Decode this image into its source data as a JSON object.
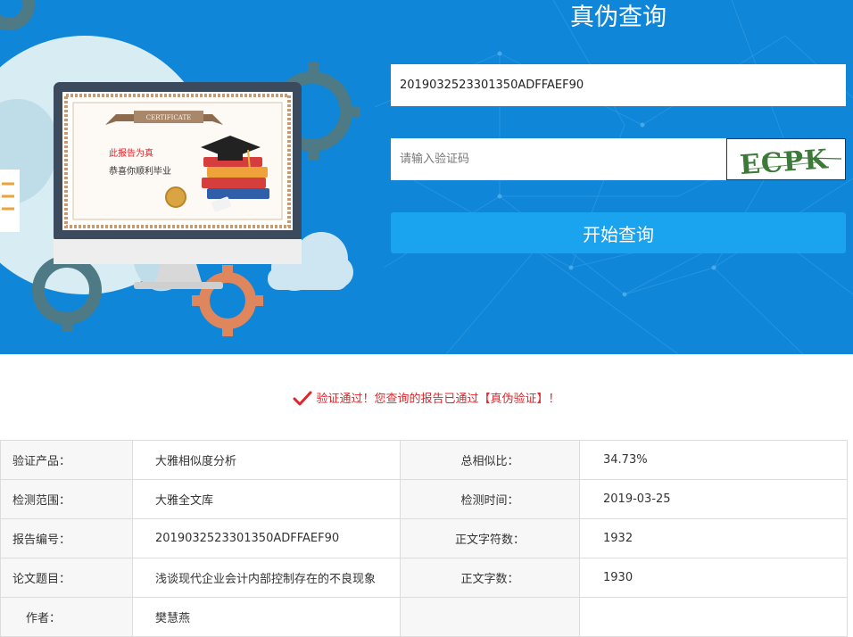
{
  "hero": {
    "title": "真伪查询",
    "certificate": {
      "banner": "CERTIFICATE",
      "line1": "此报告为真",
      "line2": "恭喜你顺利毕业"
    }
  },
  "form": {
    "report_number_value": "2019032523301350ADFFAEF90",
    "captcha_placeholder": "请输入验证码",
    "captcha_text": "ECPK",
    "query_button_label": "开始查询"
  },
  "verify": {
    "message": "验证通过！您查询的报告已通过【真伪验证】！"
  },
  "results": {
    "rows": [
      {
        "k1": "验证产品：",
        "v1": "大雅相似度分析",
        "k2": "总相似比：",
        "v2": "34.73%"
      },
      {
        "k1": "检测范围：",
        "v1": "大雅全文库",
        "k2": "检测时间：",
        "v2": "2019-03-25"
      },
      {
        "k1": "报告编号：",
        "v1": "2019032523301350ADFFAEF90",
        "k2": "正文字符数：",
        "v2": "1932"
      },
      {
        "k1": "论文题目：",
        "v1": "浅谈现代企业会计内部控制存在的不良现象",
        "k2": "正文字数：",
        "v2": "1930"
      },
      {
        "k1": "作者：",
        "v1": "樊慧燕",
        "k2": "",
        "v2": ""
      }
    ]
  },
  "colors": {
    "banner_blue": "#0f86d8",
    "button_blue": "#1aa3ee",
    "success_red": "#e0262b"
  }
}
